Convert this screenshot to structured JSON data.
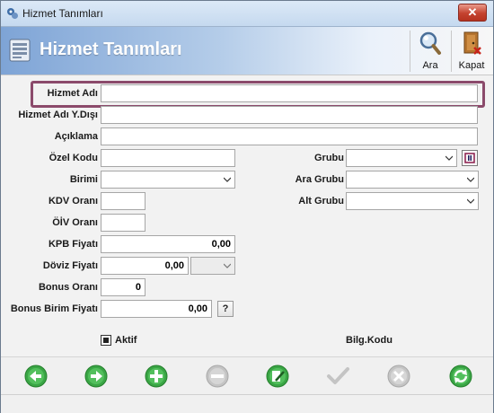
{
  "window": {
    "title": "Hizmet Tanımları",
    "close_label": "✕"
  },
  "header": {
    "title": "Hizmet Tanımları",
    "toolbar": [
      {
        "label": "Ara",
        "icon": "magnifier-icon"
      },
      {
        "label": "Kapat",
        "icon": "door-exit-icon"
      }
    ]
  },
  "form": {
    "hizmet_adi": {
      "label": "Hizmet Adı",
      "value": ""
    },
    "hizmet_adi_ydisi": {
      "label": "Hizmet Adı Y.Dışı",
      "value": ""
    },
    "aciklama": {
      "label": "Açıklama",
      "value": ""
    },
    "ozel_kodu": {
      "label": "Özel Kodu",
      "value": ""
    },
    "birimi": {
      "label": "Birimi",
      "value": ""
    },
    "kdv_orani": {
      "label": "KDV Oranı",
      "value": ""
    },
    "oiv_orani": {
      "label": "ÖİV Oranı",
      "value": ""
    },
    "kpb_fiyati": {
      "label": "KPB Fiyatı",
      "value": "0,00"
    },
    "doviz_fiyati": {
      "label": "Döviz Fiyatı",
      "value": "0,00",
      "currency": ""
    },
    "bonus_orani": {
      "label": "Bonus Oranı",
      "value": "0"
    },
    "bonus_birim_fiyati": {
      "label": "Bonus Birim Fiyatı",
      "value": "0,00",
      "help_label": "?"
    },
    "grubu": {
      "label": "Grubu",
      "value": ""
    },
    "ara_grubu": {
      "label": "Ara Grubu",
      "value": ""
    },
    "alt_grubu": {
      "label": "Alt Grubu",
      "value": ""
    },
    "aktif": {
      "label": "Aktif",
      "checked": true
    },
    "bilg_kodu": {
      "label": "Bilg.Kodu"
    }
  },
  "navbar": [
    {
      "icon": "arrow-left-icon",
      "enabled": true
    },
    {
      "icon": "arrow-right-icon",
      "enabled": true
    },
    {
      "icon": "plus-icon",
      "enabled": true
    },
    {
      "icon": "minus-icon",
      "enabled": false
    },
    {
      "icon": "edit-icon",
      "enabled": true
    },
    {
      "icon": "check-icon",
      "enabled": false
    },
    {
      "icon": "cancel-icon",
      "enabled": false
    },
    {
      "icon": "refresh-icon",
      "enabled": true
    }
  ],
  "colors": {
    "nav_green": "#3aa545",
    "nav_disabled": "#c4c4c4",
    "highlight_border": "#8b4a6b",
    "header_gradient_start": "#7ea4d6"
  }
}
